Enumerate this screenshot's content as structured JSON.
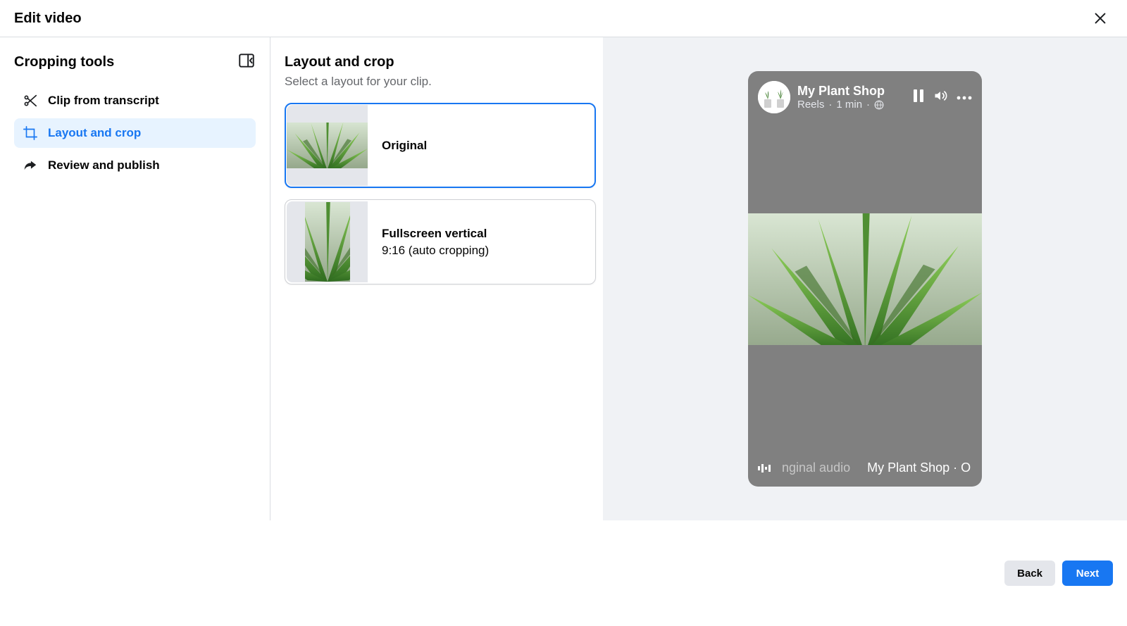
{
  "header": {
    "title": "Edit video"
  },
  "sidebar": {
    "title": "Cropping tools",
    "items": [
      {
        "label": "Clip from transcript"
      },
      {
        "label": "Layout and crop"
      },
      {
        "label": "Review and publish"
      }
    ]
  },
  "center": {
    "title": "Layout and crop",
    "subtitle": "Select a layout for your clip.",
    "options": [
      {
        "title": "Original",
        "sub": ""
      },
      {
        "title": "Fullscreen vertical",
        "sub": "9:16 (auto cropping)"
      }
    ]
  },
  "preview": {
    "page_name": "My Plant Shop",
    "meta_type": "Reels",
    "meta_sep": " · ",
    "meta_time": "1 min",
    "footer_audio": "nginal audio",
    "footer_attr": "My Plant Shop · O"
  },
  "footer": {
    "back": "Back",
    "next": "Next"
  }
}
